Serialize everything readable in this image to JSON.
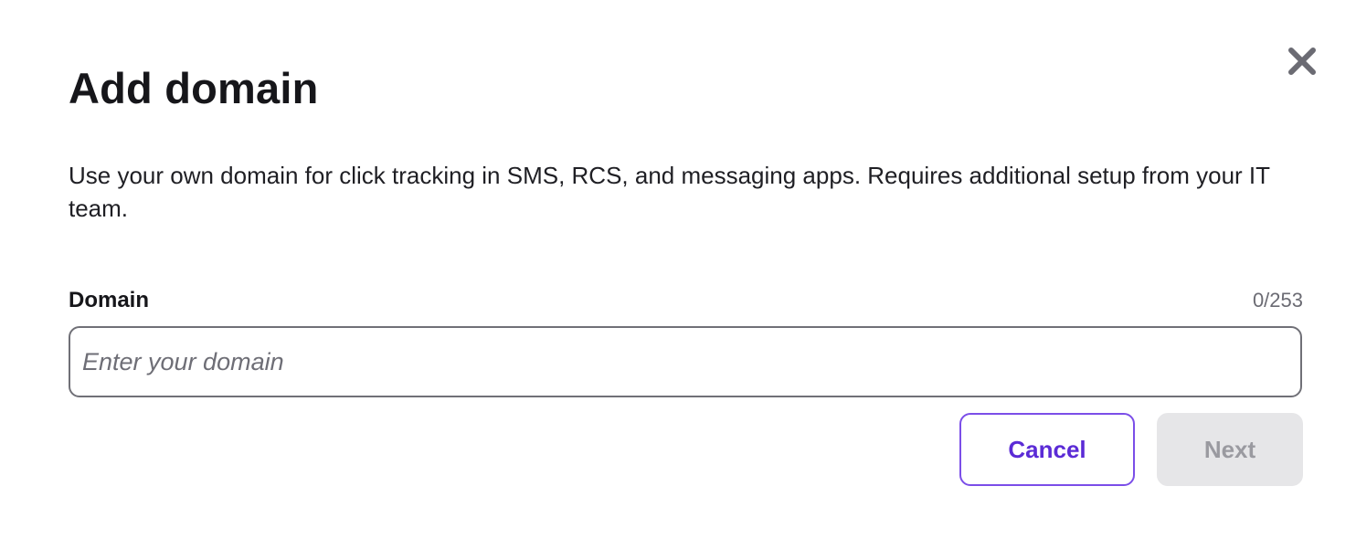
{
  "dialog": {
    "title": "Add domain",
    "description": "Use your own domain for click tracking in SMS, RCS, and messaging apps. Requires additional setup from your IT team.",
    "close_icon": "close-icon"
  },
  "field": {
    "label": "Domain",
    "counter": "0/253",
    "value": "",
    "placeholder": "Enter your domain"
  },
  "actions": {
    "cancel_label": "Cancel",
    "next_label": "Next",
    "next_disabled": true
  },
  "colors": {
    "accent": "#5b2bd6",
    "accent_border": "#7b4ee8",
    "disabled_bg": "#e6e6e8",
    "disabled_text": "#9a9aa0",
    "close_icon": "#6b6b73"
  }
}
